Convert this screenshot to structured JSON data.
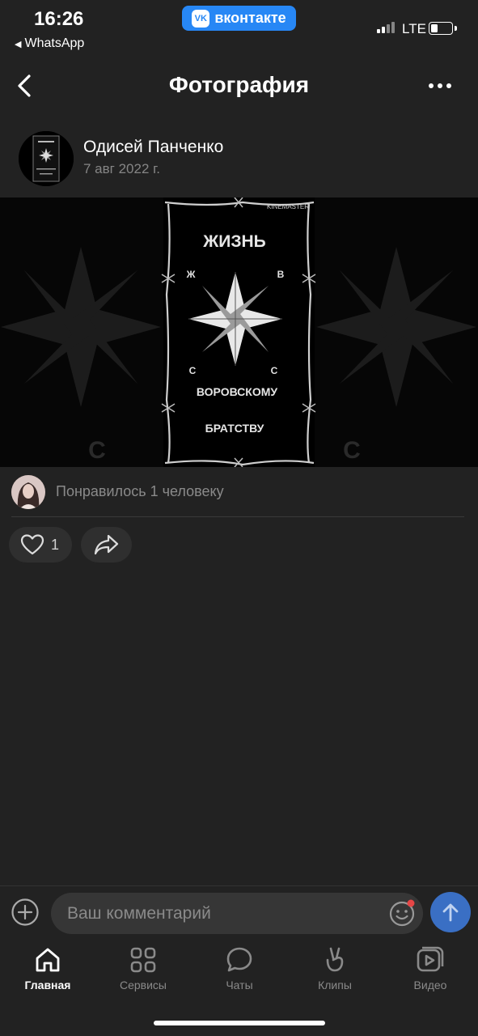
{
  "status": {
    "time": "16:26",
    "back_app": "WhatsApp",
    "network": "LTE",
    "battery_level": 0.3
  },
  "vk_pill": {
    "logo": "VK",
    "label": "вконтакте"
  },
  "nav": {
    "title": "Фотография",
    "back_icon": "chevron-left-icon",
    "more_icon": "more-horizontal-icon"
  },
  "post": {
    "author": "Одисей Панченко",
    "date": "7 авг 2022 г."
  },
  "photo": {
    "watermark": "KINEMASTER",
    "title": "ЖИЗНЬ",
    "letters": {
      "top_left": "Ж",
      "top_right": "В",
      "bottom_left": "С",
      "bottom_right": "С"
    },
    "line1": "ВОРОВСКОМУ",
    "line2": "БРАТСТВУ",
    "bg_letter": "С"
  },
  "likes": {
    "text": "Понравилось 1 человеку"
  },
  "actions": {
    "like_count": "1"
  },
  "comment": {
    "placeholder": "Ваш комментарий"
  },
  "tabs": [
    {
      "label": "Главная",
      "icon": "home-icon",
      "active": true
    },
    {
      "label": "Сервисы",
      "icon": "services-icon",
      "active": false
    },
    {
      "label": "Чаты",
      "icon": "chat-icon",
      "active": false
    },
    {
      "label": "Клипы",
      "icon": "clips-icon",
      "active": false
    },
    {
      "label": "Видео",
      "icon": "video-icon",
      "active": false
    }
  ],
  "colors": {
    "background": "#222222",
    "accent": "#2787f5",
    "send": "#3a6fc4",
    "muted": "#8a8a8a"
  }
}
